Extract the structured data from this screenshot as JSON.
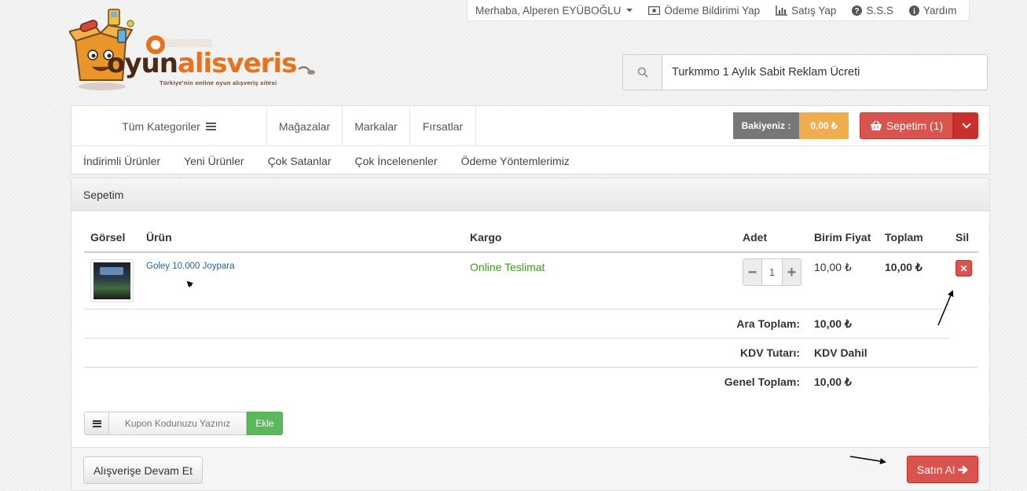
{
  "topbar": {
    "greeting": "Merhaba, Alperen EYÜBOĞLU",
    "payment_notice": "Ödeme Bildirimi Yap",
    "sell": "Satış Yap",
    "faq": "S.S.S",
    "help": "Yardım"
  },
  "logo": {
    "name_part1": "oyun",
    "name_part2": "alisveris",
    "tagline": "Türkiye'nin online oyun alışveriş sitesi"
  },
  "search": {
    "value": "Turkmmo 1 Aylık Sabit Reklam Ücreti"
  },
  "nav": {
    "categories": "Tüm Kategoriler",
    "stores": "Mağazalar",
    "brands": "Markalar",
    "deals": "Fırsatlar",
    "balance_label": "Bakiyeniz :",
    "balance_value": "0,00 ₺",
    "cart": "Sepetim (1)",
    "sub": [
      "İndirimli Ürünler",
      "Yeni Ürünler",
      "Çok Satanlar",
      "Çok İncelenenler",
      "Ödeme Yöntemlerimiz"
    ]
  },
  "cart": {
    "title": "Sepetim",
    "headers": {
      "image": "Görsel",
      "product": "Ürün",
      "shipping": "Kargo",
      "qty": "Adet",
      "unit_price": "Birim Fiyat",
      "total": "Toplam",
      "delete": "Sil"
    },
    "item": {
      "name": "Goley 10.000 Joypara",
      "shipping": "Online Teslimat",
      "qty": "1",
      "unit_price": "10,00 ₺",
      "total": "10,00 ₺",
      "delete_icon": "✕"
    },
    "summary": {
      "subtotal_label": "Ara Toplam:",
      "subtotal": "10,00 ₺",
      "vat_label": "KDV Tutarı:",
      "vat": "KDV Dahil",
      "grand_label": "Genel Toplam:",
      "grand": "10,00 ₺"
    },
    "coupon_placeholder": "Kupon Kodunuzu Yazınız",
    "coupon_add": "Ekle",
    "continue": "Alışverişe Devam Et",
    "buy": "Satın Al"
  },
  "colors": {
    "accent_red": "#d9534f",
    "accent_orange": "#f0ad4e",
    "success_green": "#5cb85c",
    "link_blue": "#2a6496"
  }
}
